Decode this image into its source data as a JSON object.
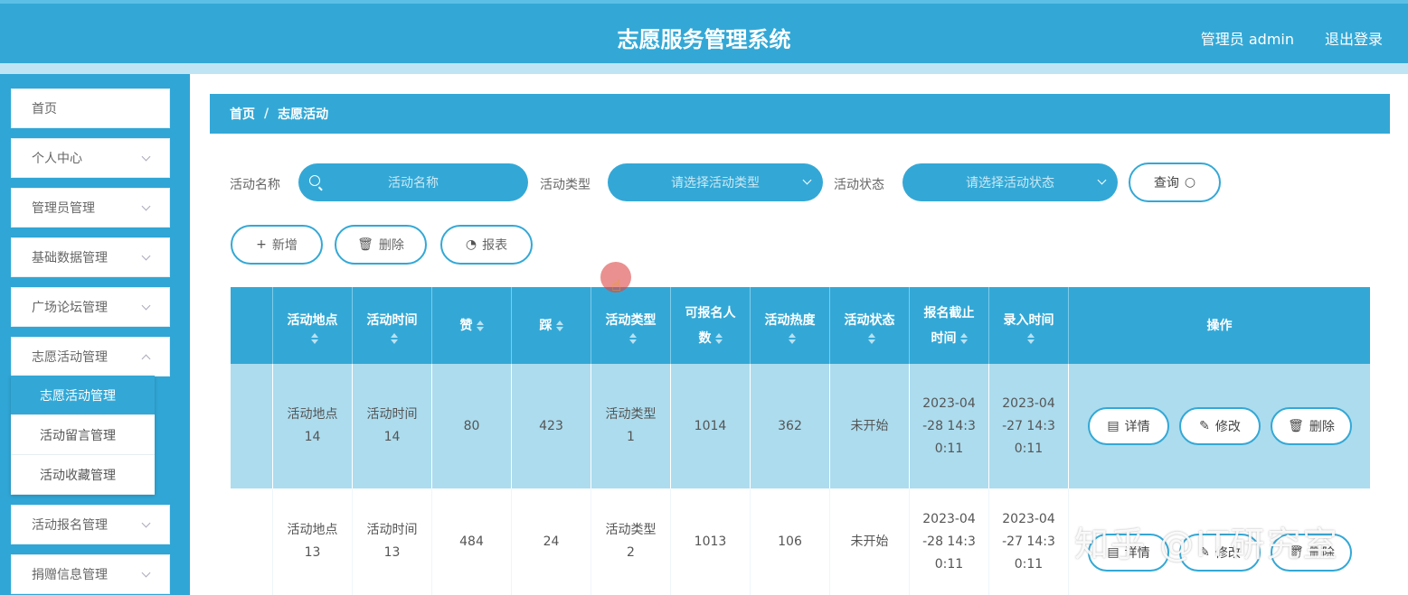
{
  "header": {
    "title": "志愿服务管理系统",
    "user": "管理员 admin",
    "logout": "退出登录"
  },
  "sidebar": {
    "items": [
      {
        "label": "首页"
      },
      {
        "label": "个人中心"
      },
      {
        "label": "管理员管理"
      },
      {
        "label": "基础数据管理"
      },
      {
        "label": "广场论坛管理"
      },
      {
        "label": "志愿活动管理"
      },
      {
        "label": "活动报名管理"
      },
      {
        "label": "捐赠信息管理"
      }
    ],
    "submenu": [
      {
        "label": "志愿活动管理"
      },
      {
        "label": "活动留言管理"
      },
      {
        "label": "活动收藏管理"
      }
    ]
  },
  "breadcrumb": {
    "home": "首页",
    "sep": "/",
    "current": "志愿活动"
  },
  "search": {
    "name_label": "活动名称",
    "name_placeholder": "活动名称",
    "type_label": "活动类型",
    "type_placeholder": "请选择活动类型",
    "status_label": "活动状态",
    "status_placeholder": "请选择活动状态",
    "query_button": "查询"
  },
  "toolbar": {
    "add": "新增",
    "delete": "删除",
    "report": "报表"
  },
  "table": {
    "headers": {
      "place": "活动地点",
      "time": "活动时间",
      "like": "赞",
      "dislike": "踩",
      "type": "活动类型",
      "capacity_1": "可报名人",
      "capacity_2": "数",
      "heat": "活动热度",
      "status": "活动状态",
      "deadline_1": "报名截止",
      "deadline_2": "时间",
      "created": "录入时间",
      "actions": "操作"
    },
    "rows": [
      {
        "place_1": "活动地点",
        "place_2": "14",
        "time_1": "活动时间",
        "time_2": "14",
        "like": "80",
        "dislike": "423",
        "type_1": "活动类型",
        "type_2": "1",
        "capacity": "1014",
        "heat": "362",
        "status": "未开始",
        "deadline_1": "2023-04",
        "deadline_2": "-28 14:3",
        "deadline_3": "0:11",
        "created_1": "2023-04",
        "created_2": "-27 14:3",
        "created_3": "0:11"
      },
      {
        "place_1": "活动地点",
        "place_2": "13",
        "time_1": "活动时间",
        "time_2": "13",
        "like": "484",
        "dislike": "24",
        "type_1": "活动类型",
        "type_2": "2",
        "capacity": "1013",
        "heat": "106",
        "status": "未开始",
        "deadline_1": "2023-04",
        "deadline_2": "-28 14:3",
        "deadline_3": "0:11",
        "created_1": "2023-04",
        "created_2": "-27 14:3",
        "created_3": "0:11"
      }
    ],
    "row_actions": {
      "detail": "详情",
      "edit": "修改",
      "delete": "删除"
    }
  },
  "watermark": "知乎 @IT研究室",
  "colors": {
    "primary": "#33a8d6",
    "row_highlight": "#acdcee"
  }
}
